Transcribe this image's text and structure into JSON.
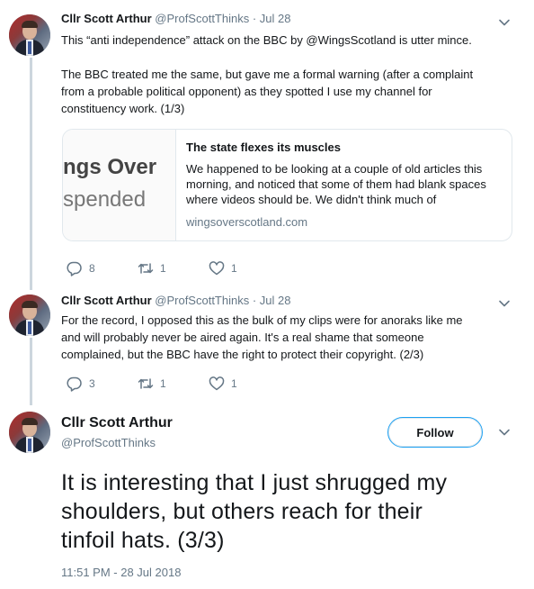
{
  "tweets": [
    {
      "name": "Cllr Scott Arthur",
      "handle": "@ProfScottThinks",
      "date": "Jul 28",
      "text_lines": [
        "This “anti independence” attack on the BBC by @WingsScotland is utter mince.",
        "",
        "The BBC treated me the same, but gave me a formal warning (after a complaint",
        "from a probable political opponent) as they spotted I use my channel for",
        "constituency work.  (1/3)"
      ],
      "card": {
        "thumb_line1": "ngs Over",
        "thumb_line2": "spended",
        "title": "The state flexes its muscles",
        "description": "We happened to be looking at a couple of old articles this morning, and noticed that some of them had blank spaces where videos should be. We didn't think much of",
        "domain": "wingsoverscotland.com"
      },
      "replies": "8",
      "retweets": "1",
      "likes": "1"
    },
    {
      "name": "Cllr Scott Arthur",
      "handle": "@ProfScottThinks",
      "date": "Jul 28",
      "text_lines": [
        "For the record, I opposed this as the bulk of my clips were for anoraks like me",
        "and will probably never be aired again. It's a real shame that someone",
        "complained, but the BBC have the right to protect their copyright. (2/3)"
      ],
      "replies": "3",
      "retweets": "1",
      "likes": "1"
    }
  ],
  "main_tweet": {
    "name": "Cllr Scott Arthur",
    "handle": "@ProfScottThinks",
    "follow_label": "Follow",
    "text_lines": [
      "It is interesting that I just shrugged my",
      "shoulders, but others reach for their",
      "tinfoil hats.  (3/3)"
    ],
    "timestamp": "11:51 PM - 28 Jul 2018"
  },
  "colors": {
    "accent": "#1da1f2",
    "secondary_text": "#657786",
    "thread_line": "#ccd6dd"
  }
}
